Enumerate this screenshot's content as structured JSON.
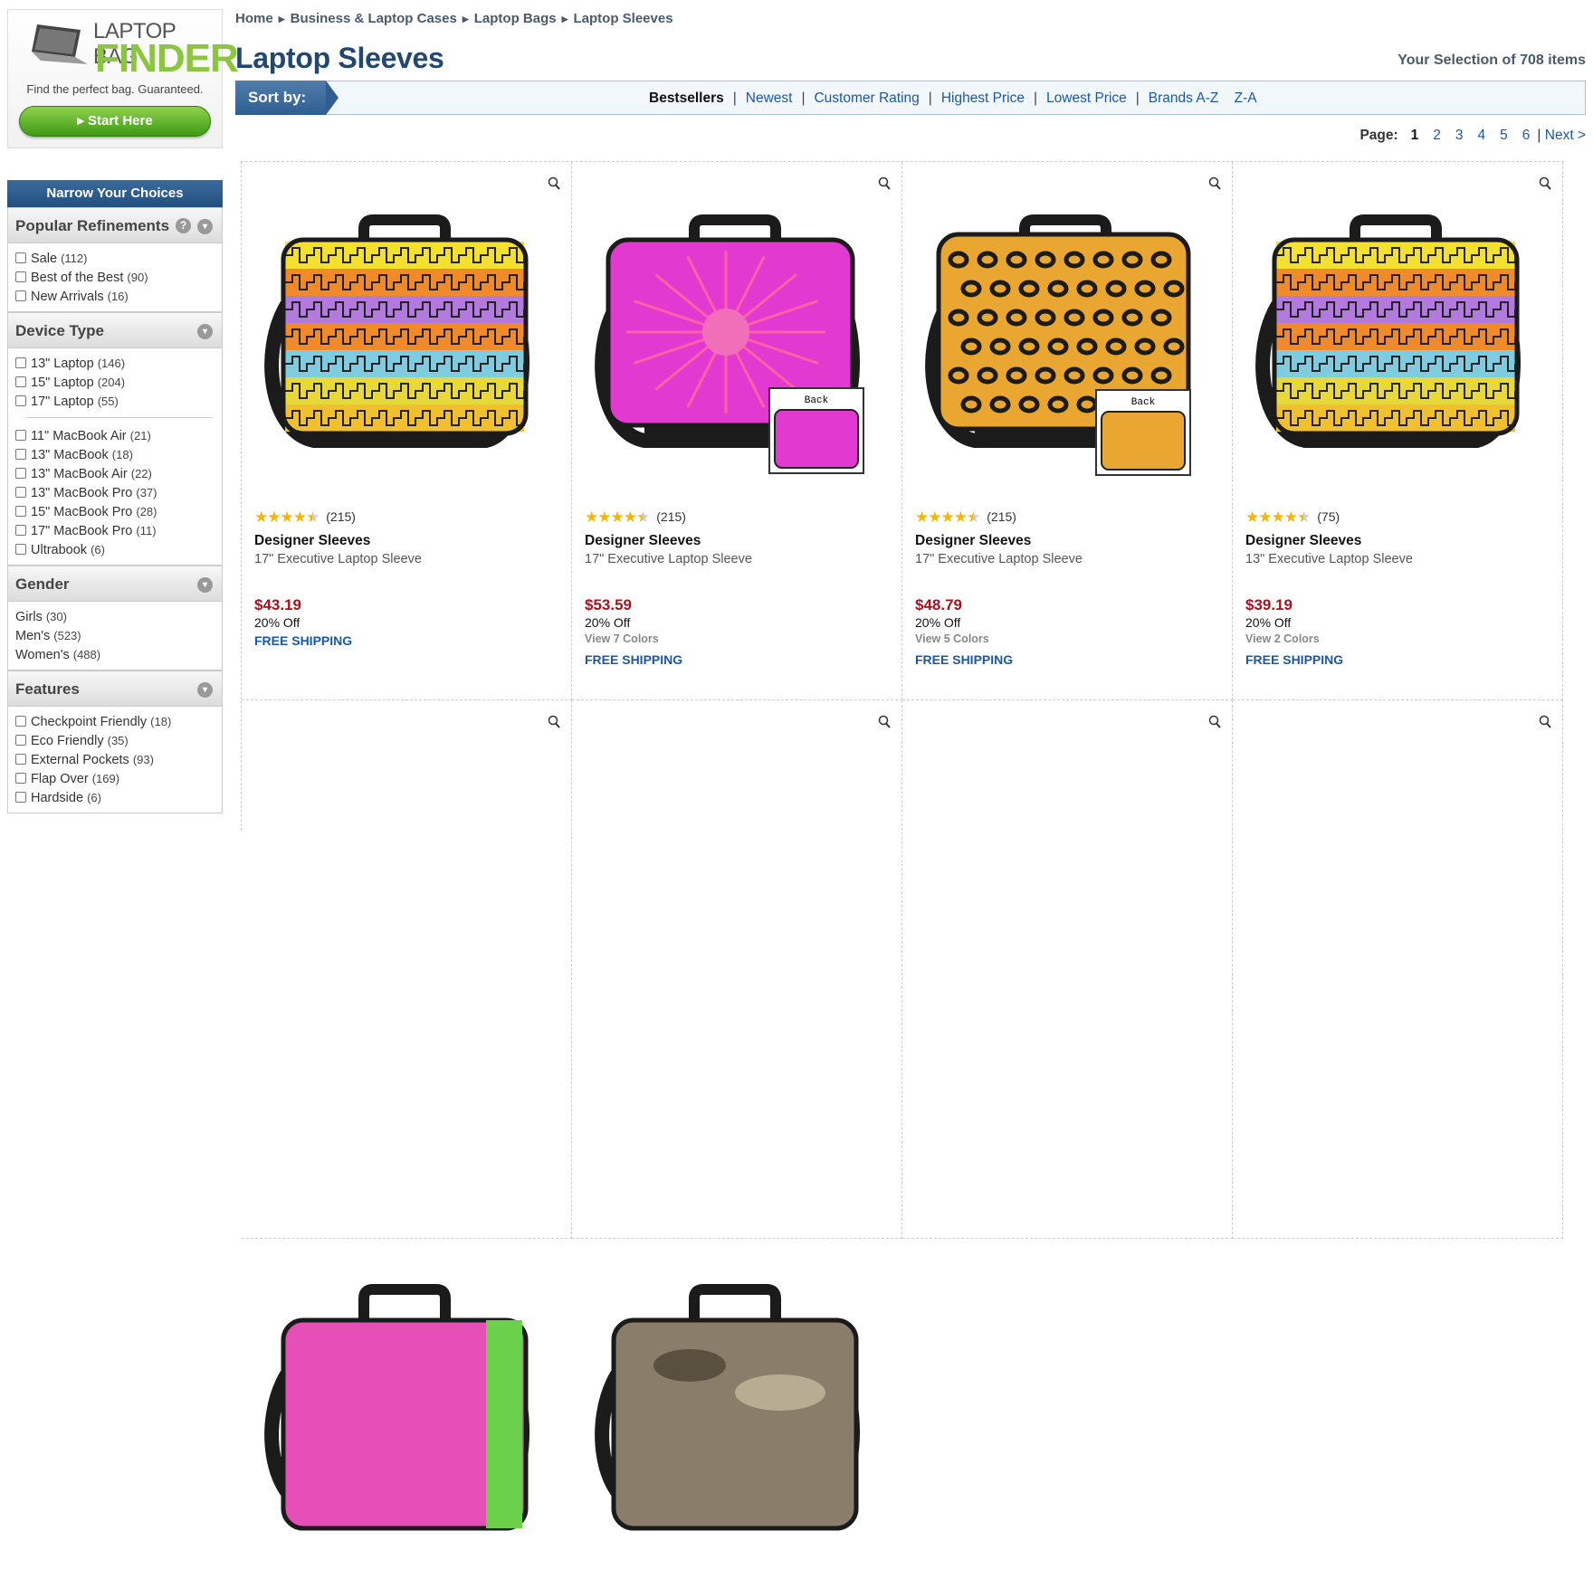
{
  "finder": {
    "line1": "LAPTOP BAG",
    "line2": "FINDER",
    "tagline": "Find the perfect bag. Guaranteed.",
    "start": "Start Here"
  },
  "narrow": "Narrow Your Choices",
  "panels": [
    {
      "title": "Popular Refinements",
      "help": "?",
      "checkbox": true,
      "groups": [
        [
          {
            "label": "Sale",
            "count": "(112)"
          },
          {
            "label": "Best of the Best",
            "count": "(90)"
          },
          {
            "label": "New Arrivals",
            "count": "(16)"
          }
        ]
      ]
    },
    {
      "title": "Device Type",
      "checkbox": true,
      "groups": [
        [
          {
            "label": "13\" Laptop",
            "count": "(146)"
          },
          {
            "label": "15\" Laptop",
            "count": "(204)"
          },
          {
            "label": "17\" Laptop",
            "count": "(55)"
          }
        ],
        [
          {
            "label": "11\" MacBook Air",
            "count": "(21)"
          },
          {
            "label": "13\" MacBook",
            "count": "(18)"
          },
          {
            "label": "13\" MacBook Air",
            "count": "(22)"
          },
          {
            "label": "13\" MacBook Pro",
            "count": "(37)"
          },
          {
            "label": "15\" MacBook Pro",
            "count": "(28)"
          },
          {
            "label": "17\" MacBook Pro",
            "count": "(11)"
          },
          {
            "label": "Ultrabook",
            "count": "(6)"
          }
        ]
      ]
    },
    {
      "title": "Gender",
      "checkbox": false,
      "groups": [
        [
          {
            "label": "Girls",
            "count": "(30)"
          },
          {
            "label": "Men's",
            "count": "(523)"
          },
          {
            "label": "Women's",
            "count": "(488)"
          }
        ]
      ]
    },
    {
      "title": "Features",
      "checkbox": true,
      "groups": [
        [
          {
            "label": "Checkpoint Friendly",
            "count": "(18)"
          },
          {
            "label": "Eco Friendly",
            "count": "(35)"
          },
          {
            "label": "External Pockets",
            "count": "(93)"
          },
          {
            "label": "Flap Over",
            "count": "(169)"
          },
          {
            "label": "Hardside",
            "count": "(6)"
          }
        ]
      ]
    }
  ],
  "breadcrumb": [
    "Home",
    "Business & Laptop Cases",
    "Laptop Bags",
    "Laptop Sleeves"
  ],
  "page_title": "Laptop Sleeves",
  "selection": "Your Selection of 708 items",
  "sort": {
    "label": "Sort by:",
    "options": [
      "Bestsellers",
      "Newest",
      "Customer Rating",
      "Highest Price",
      "Lowest Price",
      "Brands A-Z",
      "Z-A"
    ],
    "active": "Bestsellers"
  },
  "pager": {
    "label": "Page:",
    "pages": [
      "1",
      "2",
      "3",
      "4",
      "5",
      "6"
    ],
    "current": "1",
    "next": "Next >"
  },
  "back_label": "Back",
  "products": [
    {
      "brand": "Designer Sleeves",
      "desc": "17\" Executive Laptop Sleeve",
      "rating": 4.5,
      "reviews": "(215)",
      "price": "$43.19",
      "off": "20% Off",
      "colors": "",
      "shipping": "FREE SHIPPING",
      "pattern": "greek"
    },
    {
      "brand": "Designer Sleeves",
      "desc": "17\" Executive Laptop Sleeve",
      "rating": 4.5,
      "reviews": "(215)",
      "price": "$53.59",
      "off": "20% Off",
      "colors": "View 7 Colors",
      "shipping": "FREE SHIPPING",
      "pattern": "pink"
    },
    {
      "brand": "Designer Sleeves",
      "desc": "17\" Executive Laptop Sleeve",
      "rating": 4.5,
      "reviews": "(215)",
      "price": "$48.79",
      "off": "20% Off",
      "colors": "View 5 Colors",
      "shipping": "FREE SHIPPING",
      "pattern": "leopard"
    },
    {
      "brand": "Designer Sleeves",
      "desc": "13\" Executive Laptop Sleeve",
      "rating": 4.5,
      "reviews": "(75)",
      "price": "$39.19",
      "off": "20% Off",
      "colors": "View 2 Colors",
      "shipping": "FREE SHIPPING",
      "pattern": "greek"
    },
    {
      "pattern": "rainbow"
    },
    {
      "pattern": "camo"
    },
    {
      "pattern": "none"
    },
    {
      "pattern": "none"
    }
  ]
}
